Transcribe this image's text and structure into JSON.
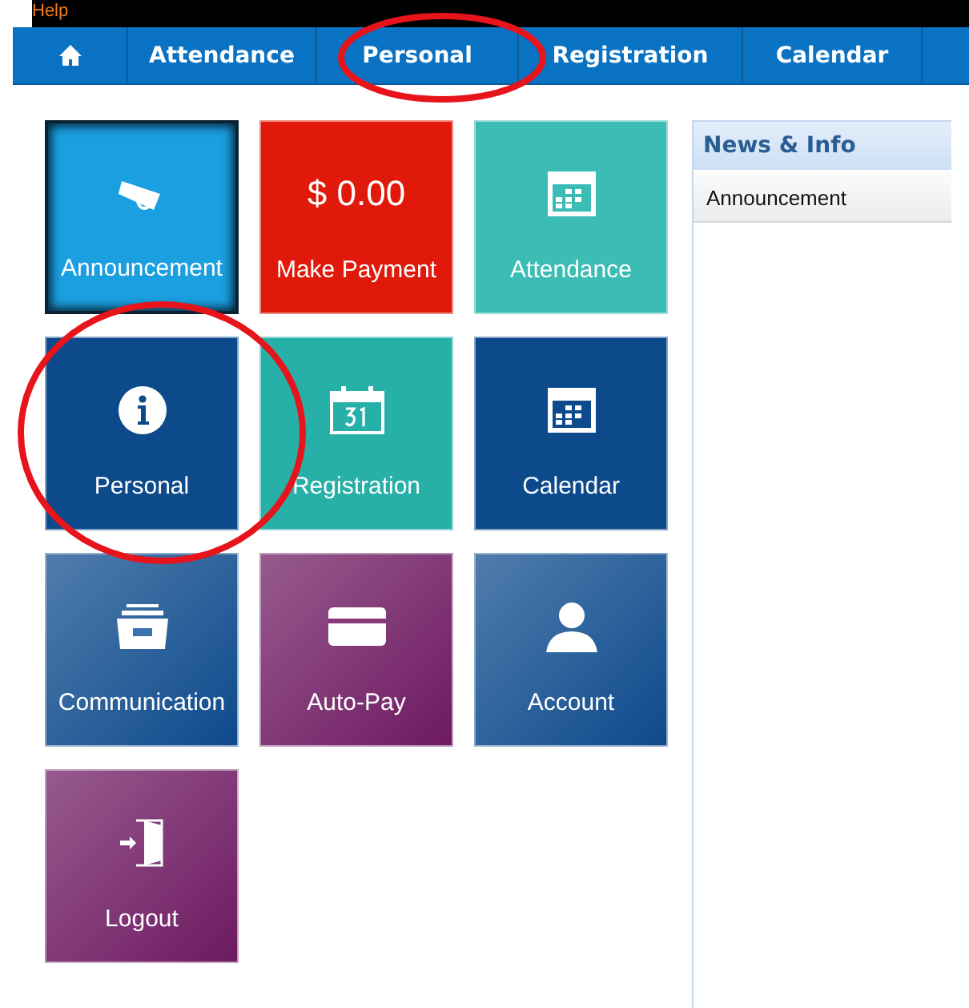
{
  "help_link": "Help",
  "nav": [
    {
      "kind": "home"
    },
    {
      "kind": "text",
      "label": "Attendance"
    },
    {
      "kind": "text",
      "label": "Personal"
    },
    {
      "kind": "text",
      "label": "Registration"
    },
    {
      "kind": "text",
      "label": "Calendar"
    },
    {
      "kind": "blank"
    }
  ],
  "tiles": [
    {
      "label": "Announcement",
      "kind": "icon",
      "color": "#1a9fe0",
      "gradient": false,
      "selected": true
    },
    {
      "label": "Make Payment",
      "kind": "amount",
      "amount": "$ 0.00",
      "color": "#e0190a",
      "gradient": false,
      "selected": false
    },
    {
      "label": "Attendance",
      "kind": "icon",
      "color": "#3bbcb4",
      "gradient": false,
      "selected": false
    },
    {
      "label": "Personal",
      "kind": "icon",
      "color": "#0d4a8c",
      "gradient": false,
      "selected": false
    },
    {
      "label": "Registration",
      "kind": "icon",
      "color": "#26b0a8",
      "gradient": false,
      "selected": false
    },
    {
      "label": "Calendar",
      "kind": "icon",
      "color": "#0d4a8c",
      "gradient": false,
      "selected": false
    },
    {
      "label": "Communication",
      "kind": "icon",
      "color": "#0d4a8c",
      "gradient": true,
      "selected": false
    },
    {
      "label": "Auto-Pay",
      "kind": "icon",
      "color": "#6e1a62",
      "gradient": true,
      "selected": false
    },
    {
      "label": "Account",
      "kind": "icon",
      "color": "#0d4a8c",
      "gradient": true,
      "selected": false
    },
    {
      "label": "Logout",
      "kind": "icon",
      "color": "#6e1a62",
      "gradient": true,
      "selected": false
    }
  ],
  "news": {
    "title": "News & Info",
    "items": [
      "Announcement"
    ]
  }
}
